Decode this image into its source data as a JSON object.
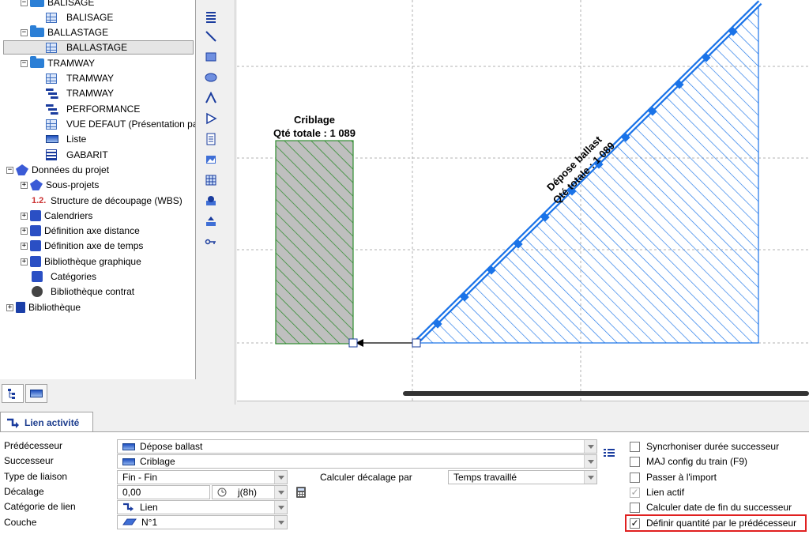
{
  "tree": {
    "items": [
      {
        "label": "BALISAGE"
      },
      {
        "label": "BALISAGE"
      },
      {
        "label": "BALLASTAGE"
      },
      {
        "label": "BALLASTAGE"
      },
      {
        "label": "TRAMWAY"
      },
      {
        "label": "TRAMWAY"
      },
      {
        "label": "TRAMWAY"
      },
      {
        "label": "PERFORMANCE"
      },
      {
        "label": "VUE DEFAUT (Présentation par"
      },
      {
        "label": "Liste"
      },
      {
        "label": "GABARIT"
      },
      {
        "label": "Données du projet"
      },
      {
        "label": "Sous-projets"
      },
      {
        "label": "Structure de découpage (WBS)"
      },
      {
        "label": "Calendriers"
      },
      {
        "label": "Définition axe distance"
      },
      {
        "label": "Définition axe de temps"
      },
      {
        "label": "Bibliothèque graphique"
      },
      {
        "label": "Catégories"
      },
      {
        "label": "Bibliothèque contrat"
      },
      {
        "label": "Bibliothèque"
      }
    ],
    "wbs_glyph": "1.2."
  },
  "canvas": {
    "criblage_title": "Criblage",
    "criblage_qty": "Qté totale : 1 089",
    "depose_title": "Dépose ballast",
    "depose_qty": "Qté totale : 1 089",
    "colors": {
      "criblage_fill": "#bfbfbf",
      "criblage_hatch": "#2e8b2e",
      "depose_hatch": "#1a73e8"
    }
  },
  "lien": {
    "tab_label": "Lien activité",
    "labels": {
      "predecesseur": "Prédécesseur",
      "successeur": "Successeur",
      "type_liaison": "Type de liaison",
      "decalage": "Décalage",
      "categorie": "Catégorie de lien",
      "couche": "Couche",
      "calculer_decalage": "Calculer décalage par"
    },
    "values": {
      "predecesseur": "Dépose ballast",
      "successeur": "Criblage",
      "type_liaison": "Fin - Fin",
      "decalage": "0,00",
      "decalage_unit": "j(8h)",
      "categorie": "Lien",
      "couche": "N°1",
      "calculer_decalage": "Temps travaillé"
    },
    "checkboxes": [
      {
        "label": "Syncrhoniser durée successeur",
        "checked": false
      },
      {
        "label": "MAJ config du train (F9)",
        "checked": false
      },
      {
        "label": "Passer à l'import",
        "checked": false
      },
      {
        "label": "Lien actif",
        "checked": true
      },
      {
        "label": "Calculer date de fin du successeur",
        "checked": false
      },
      {
        "label": "Définir quantité par le prédécesseur",
        "checked": true
      }
    ]
  }
}
